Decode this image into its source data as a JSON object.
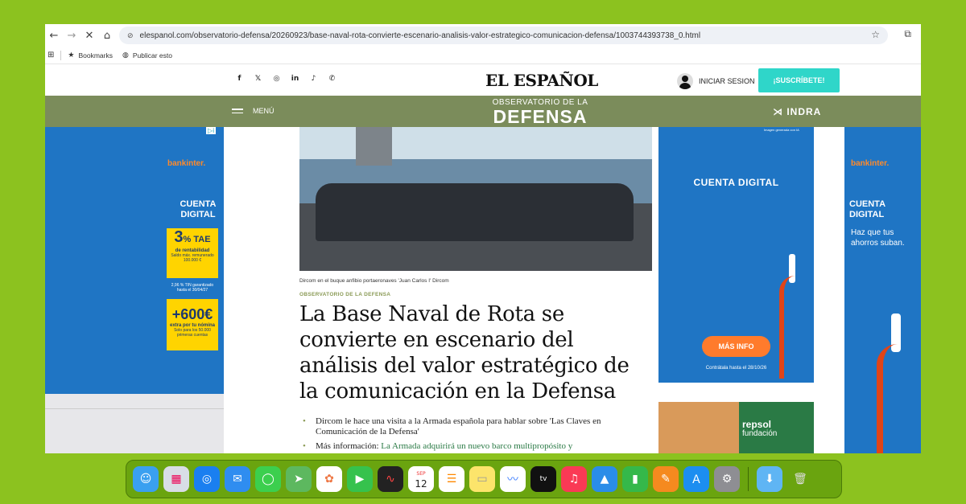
{
  "browser": {
    "url": "elespanol.com/observatorio-defensa/20260923/base-naval-rota-convierte-escenario-analisis-valor-estrategico-comunicacion-defensa/1003744393738_0.html",
    "bookmarks": [
      "Bookmarks",
      "Publicar esto"
    ]
  },
  "header": {
    "logo": "EL ESPAÑOL",
    "login": "INICIAR SESION",
    "subscribe": "¡SUSCRÍBETE!",
    "socials": [
      "f",
      "𝕏",
      "◎",
      "in",
      "♪",
      "✆"
    ]
  },
  "section": {
    "menu": "MENÚ",
    "title_top": "OBSERVATORIO DE LA",
    "title_big": "DEFENSA",
    "sponsor": "⋊ INDRA"
  },
  "ad_left": {
    "brand": "bankinter.",
    "headline": "CUENTA\nDIGITAL",
    "rate": "3",
    "rate_unit": "% TAE",
    "rate_sub": "de rentabilidad",
    "rate_note": "Saldo máx. remunerado 100.000 €",
    "tin": "2,96 % TIN garantizado hasta el 30/04/27",
    "bonus": "+600€",
    "bonus_sub": "extra por tu nómina",
    "bonus_note": "Solo para los 50.000 primeras cuentas"
  },
  "ad_right": {
    "note": "Imagen generada con IA",
    "title": "CUENTA DIGITAL",
    "button": "MÁS INFO",
    "hasta": "Contrátala hasta el 28/10/26"
  },
  "ad_far": {
    "brand": "bankinter.",
    "headline": "CUENTA DIGITAL",
    "text": "Haz que tus ahorros suban."
  },
  "ad_repsol": {
    "brand": "repsol",
    "sub": "fundación"
  },
  "article": {
    "caption": "Dircom en el buque anfibio portaeronaves 'Juan Carlos I'  Dircom",
    "kicker": "OBSERVATORIO DE LA DEFENSA",
    "headline": "La Base Naval de Rota se convierte en escenario del análisis del valor estratégico de la comunicación en la Defensa",
    "bullet1": "Dircom le hace una visita a la Armada española para hablar sobre 'Las Claves en Comunicación de la Defensa'",
    "bullet2_prefix": "Más información: ",
    "bullet2_link": "La Armada adquirirá un nuevo barco multipropósito y"
  },
  "dock": {
    "apps": [
      "finder-icon",
      "launchpad-icon",
      "safari-icon",
      "mail-icon",
      "messages-icon",
      "maps-icon",
      "photos-icon",
      "facetime-icon",
      "voice-memos-icon",
      "calendar-icon",
      "reminders-icon",
      "notes-icon",
      "freeform-icon",
      "apple-tv-icon",
      "music-icon",
      "keynote-icon",
      "numbers-icon",
      "pages-icon",
      "app-store-icon",
      "system-settings-icon",
      "downloads-folder-icon",
      "trash-icon"
    ],
    "calendar_month": "SEP",
    "calendar_day": "12"
  }
}
